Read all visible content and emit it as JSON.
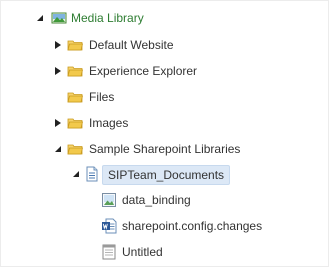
{
  "tree": {
    "nodes": [
      {
        "label": "Media Library",
        "state": "expanded",
        "icon": "media-library-icon"
      },
      {
        "label": "Default Website",
        "state": "collapsed",
        "icon": "folder-icon"
      },
      {
        "label": "Experience Explorer",
        "state": "collapsed",
        "icon": "folder-icon"
      },
      {
        "label": "Files",
        "state": "leaf",
        "icon": "folder-icon"
      },
      {
        "label": "Images",
        "state": "collapsed",
        "icon": "folder-icon"
      },
      {
        "label": "Sample Sharepoint Libraries",
        "state": "expanded",
        "icon": "folder-icon"
      },
      {
        "label": "SIPTeam_Documents",
        "state": "expanded",
        "icon": "document-list-icon",
        "selected": true
      },
      {
        "label": "data_binding",
        "state": "leaf",
        "icon": "image-file-icon"
      },
      {
        "label": "sharepoint.config.changes",
        "state": "leaf",
        "icon": "word-document-icon"
      },
      {
        "label": "Untitled",
        "state": "leaf",
        "icon": "blank-document-icon"
      }
    ]
  },
  "colors": {
    "root_label": "#2e7d32",
    "selection_background": "#dce8f6",
    "folder": "#f2c94c",
    "text": "#333333"
  }
}
